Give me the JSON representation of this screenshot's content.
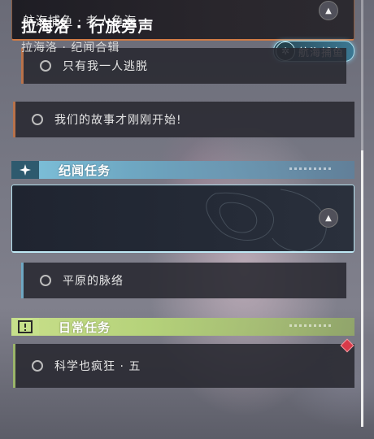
{
  "main_quest": {
    "subtitle": "航海捕鱼 · 老人鱼海",
    "badge_label": "航海捕鱼",
    "sub_items": [
      {
        "label": "只有我一人逃脱"
      },
      {
        "label": "我们的故事才刚刚开始!"
      }
    ]
  },
  "legend_section": {
    "title": "纪闻任务",
    "card": {
      "title": "拉海洛 · 行旅旁声",
      "subtitle": "拉海洛 · 纪闻合辑"
    },
    "sub_items": [
      {
        "label": "平原的脉络"
      }
    ]
  },
  "daily_section": {
    "title": "日常任务",
    "items": [
      {
        "label": "科学也疯狂 · 五"
      }
    ]
  },
  "colors": {
    "main_accent": "#d07a44",
    "legend_accent": "#7fc3dc",
    "daily_accent": "#b5d27a",
    "notice_red": "#d83a4a"
  },
  "icons": [
    "chevron-up-icon",
    "compass-icon",
    "sparkle-icon",
    "exclamation-icon",
    "circle-icon",
    "diamond-marker-icon"
  ]
}
